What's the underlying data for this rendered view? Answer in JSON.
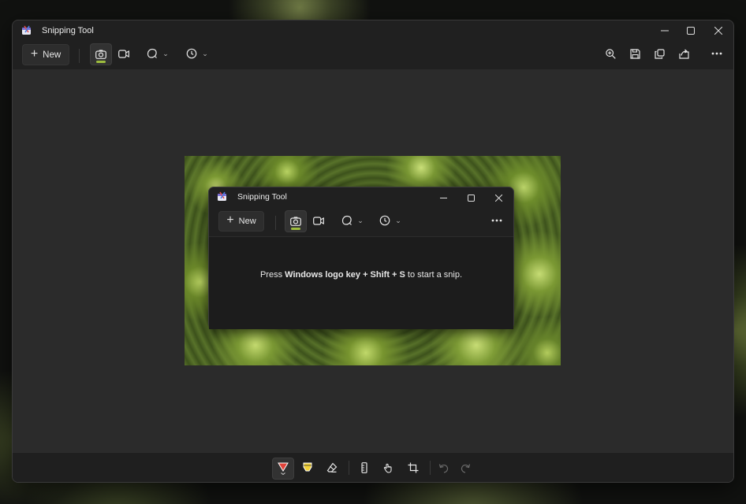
{
  "window": {
    "title": "Snipping Tool",
    "toolbar": {
      "new_label": "New",
      "modes": [
        "camera-icon",
        "video-icon"
      ],
      "shape_menu": "freeform-shape-icon",
      "delay_menu": "clock-icon",
      "right_actions": [
        "zoom-in-icon",
        "save-icon",
        "copy-icon",
        "share-icon",
        "more-icon"
      ]
    }
  },
  "screenshot_preview": {
    "title": "Snipping Tool",
    "new_label": "New",
    "message_prefix": "Press ",
    "message_bold": "Windows logo key + Shift + S",
    "message_suffix": " to start a snip."
  },
  "annotation_bar": {
    "tools": [
      "ballpoint-pen-icon",
      "highlighter-icon",
      "eraser-icon",
      "ruler-icon",
      "touch-writing-icon",
      "crop-icon",
      "undo-icon",
      "redo-icon"
    ]
  },
  "colors": {
    "accent": "#9ebd3e",
    "pen_red": "#e0433a",
    "highlighter_yellow": "#f2d13a"
  }
}
